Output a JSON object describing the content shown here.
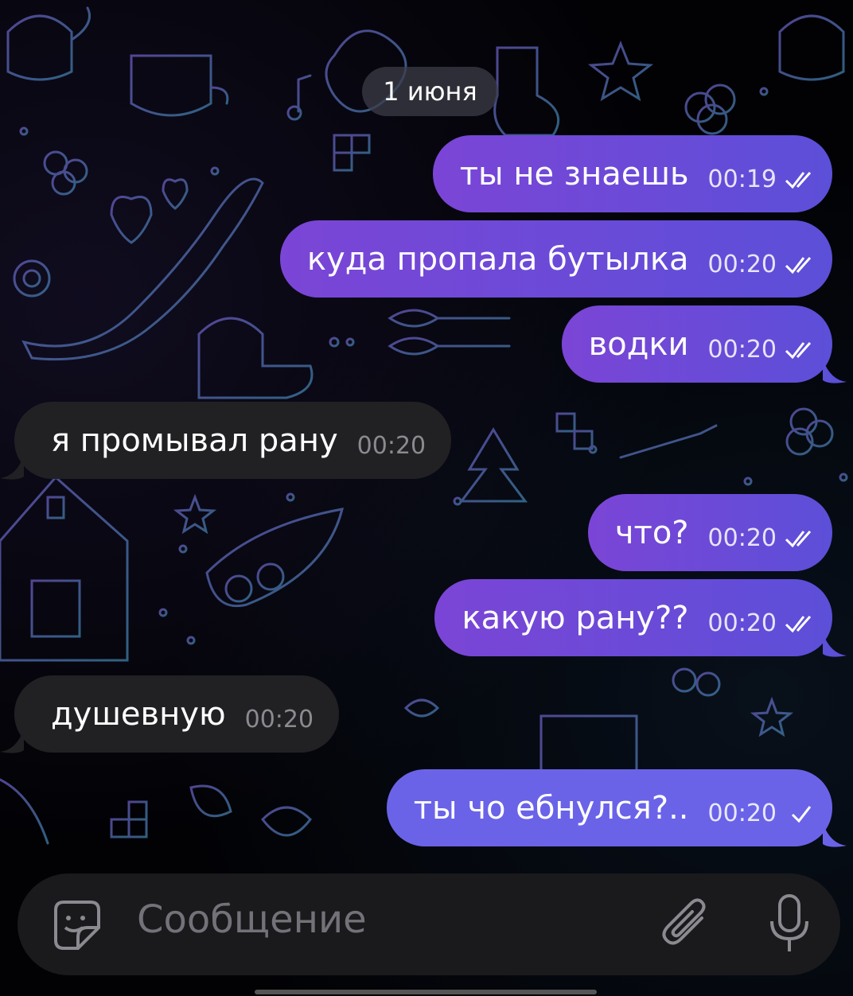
{
  "chat": {
    "date_label": "1 июня",
    "messages": [
      {
        "direction": "out",
        "text": "ты не знаешь",
        "time": "00:19",
        "status": "read"
      },
      {
        "direction": "out",
        "text": "куда пропала бутылка",
        "time": "00:20",
        "status": "read"
      },
      {
        "direction": "out",
        "text": "водки",
        "time": "00:20",
        "status": "read"
      },
      {
        "direction": "in",
        "text": "я промывал рану",
        "time": "00:20"
      },
      {
        "direction": "out",
        "text": "что?",
        "time": "00:20",
        "status": "read"
      },
      {
        "direction": "out",
        "text": "какую рану??",
        "time": "00:20",
        "status": "read"
      },
      {
        "direction": "in",
        "text": "душевную",
        "time": "00:20"
      },
      {
        "direction": "out",
        "text": "ты чо ебнулся?..",
        "time": "00:20",
        "status": "sent"
      }
    ]
  },
  "composer": {
    "placeholder": "Сообщение",
    "icons": [
      "sticker-icon",
      "paperclip-icon",
      "microphone-icon"
    ]
  },
  "colors": {
    "outgoing_bubble": "#7b45d6",
    "incoming_bubble": "#212124",
    "background": "#000000"
  }
}
